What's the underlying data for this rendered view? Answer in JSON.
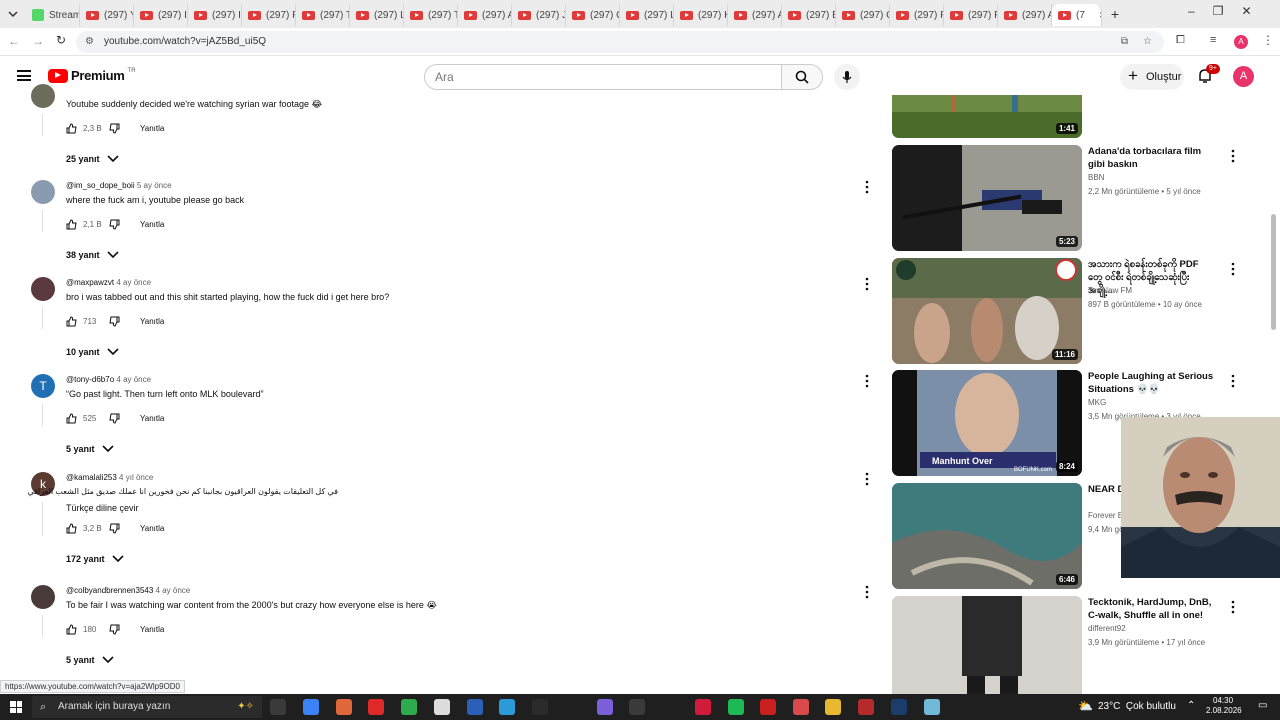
{
  "browser": {
    "tabs": [
      {
        "label": "Stream",
        "kind": "first"
      },
      {
        "label": "(297) Y",
        "kind": "yt"
      },
      {
        "label": "(297) I",
        "kind": "yt"
      },
      {
        "label": "(297) I",
        "kind": "yt"
      },
      {
        "label": "(297) P",
        "kind": "yt"
      },
      {
        "label": "(297) T",
        "kind": "yt"
      },
      {
        "label": "(297) L",
        "kind": "yt"
      },
      {
        "label": "(297) T",
        "kind": "yt"
      },
      {
        "label": "(297) A",
        "kind": "yt"
      },
      {
        "label": "(297) J",
        "kind": "yt"
      },
      {
        "label": "(297) C",
        "kind": "yt"
      },
      {
        "label": "(297) L",
        "kind": "yt"
      },
      {
        "label": "(297) K",
        "kind": "yt"
      },
      {
        "label": "(297) A",
        "kind": "yt"
      },
      {
        "label": "(297) B",
        "kind": "yt"
      },
      {
        "label": "(297) C",
        "kind": "yt"
      },
      {
        "label": "(297) F",
        "kind": "yt"
      },
      {
        "label": "(297) F",
        "kind": "yt"
      },
      {
        "label": "(297) A",
        "kind": "yt"
      },
      {
        "label": "(7",
        "kind": "active"
      }
    ],
    "url": "youtube.com/watch?v=jAZ5Bd_ui5Q",
    "status_url": "https://www.youtube.com/watch?v=aja2Wlp9OD0"
  },
  "youtube": {
    "logo_text": "Premium",
    "logo_badge": "TR",
    "search_placeholder": "Ara",
    "create_label": "Oluştur",
    "notif_count": "9+",
    "avatar_letter": "A"
  },
  "comments": [
    {
      "user": "",
      "age": "",
      "text": "Youtube suddenly decided we're watching syrian war footage 😂",
      "likes": "2,3 B",
      "reply_label": "Yanıtla",
      "replies": "25 yanıt",
      "avatar_color": "#6d6b5a",
      "avatar_letter": ""
    },
    {
      "user": "@im_so_dope_boii",
      "age": "5 ay önce",
      "text": "where the fuck am i, youtube please go back",
      "likes": "2,1 B",
      "reply_label": "Yanıtla",
      "replies": "38 yanıt",
      "avatar_color": "#8a9bb0",
      "avatar_letter": ""
    },
    {
      "user": "@maxpawzvt",
      "age": "4 ay önce",
      "text": "bro i was tabbed out and this shit started playing, how the fuck did i get here bro?",
      "likes": "713",
      "reply_label": "Yanıtla",
      "replies": "10 yanıt",
      "avatar_color": "#5a3a3e",
      "avatar_letter": ""
    },
    {
      "user": "@tony-d6b7o",
      "age": "4 ay önce",
      "text": "“Go past light. Then turn left onto MLK boulevard”",
      "likes": "525",
      "reply_label": "Yanıtla",
      "replies": "5 yanıt",
      "avatar_color": "#1f6fb2",
      "avatar_letter": "T"
    },
    {
      "user": "@kamalali253",
      "age": "4 yıl önce",
      "text": "في كل التعليقات يقولون العراقيون بجانبنا كم نحن فخورين انا عملك صديق مثل الشعب العراقي",
      "translate": "Türkçe diline çevir",
      "likes": "3,2 B",
      "reply_label": "Yanıtla",
      "replies": "172 yanıt",
      "avatar_color": "#5b3a32",
      "avatar_letter": "k"
    },
    {
      "user": "@colbyandbrennen3543",
      "age": "4 ay önce",
      "text": "To be fair I was watching war content from the 2000's but crazy how everyone else is here 😭",
      "likes": "180",
      "reply_label": "Yanıtla",
      "replies": "5 yanıt",
      "avatar_color": "#4a3b3b",
      "avatar_letter": ""
    }
  ],
  "related": [
    {
      "title": "",
      "channel": "",
      "stats": "",
      "duration": "1:41",
      "thumb_color": "#5f7a3c"
    },
    {
      "title": "Adana'da torbacılara film gibi baskın",
      "channel": "BBN",
      "stats": "2,2 Mn görüntüleme • 5 yıl önce",
      "duration": "5:23",
      "thumb_color": "#70706b"
    },
    {
      "title": "အသားက ရဲစခန်းတစ်ခုကို PDF တွေ ဝင်စီး ရဲတစ်ချို့သေဆုံးပြီး အချို့...",
      "channel": "TawNaw FM",
      "stats": "897 B görüntüleme • 10 ay önce",
      "duration": "11:16",
      "thumb_color": "#7a6a58"
    },
    {
      "title": "People Laughing at Serious Situations 💀💀",
      "channel": "MKG",
      "stats": "3,5 Mn görüntüleme • 3 yıl önce",
      "duration": "8:24",
      "thumb_color": "#26264a"
    },
    {
      "title": "NEAR D GoPro a",
      "channel": "Forever E",
      "stats": "9,4 Mn gö",
      "duration": "6:46",
      "thumb_color": "#4e6b6e"
    },
    {
      "title": "Tecktonik, HardJump, DnB, C-walk, Shuffle all in one!",
      "channel": "different92",
      "stats": "3,9 Mn görüntüleme • 17 yıl önce",
      "duration": "",
      "thumb_color": "#cfcfcc"
    }
  ],
  "thumb_overlay": {
    "caption": "Manhunt Over",
    "site": "BOFUNK.com"
  },
  "taskbar": {
    "search_placeholder": "Aramak için buraya yazın",
    "weather": "23°C  Çok bulutlu",
    "time": "04:30",
    "date": "2.08.2026"
  }
}
